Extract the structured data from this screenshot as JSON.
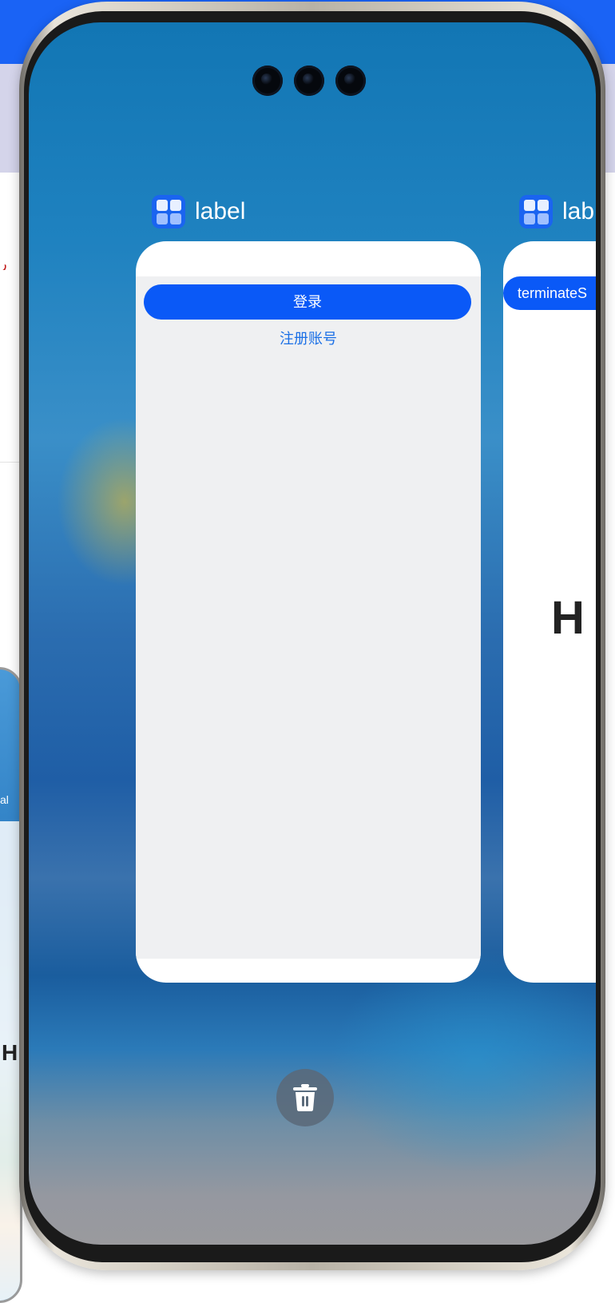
{
  "background": {
    "left_app_label_fragment": "al",
    "left_app_big_text_fragment": "H",
    "red_text_fragment": "ر"
  },
  "recent_apps": [
    {
      "label": "label",
      "icon": "app-grid-icon",
      "content": {
        "primary_button": "登录",
        "link": "注册账号"
      }
    },
    {
      "label": "lab",
      "icon": "app-grid-icon",
      "content": {
        "button": "terminateS",
        "big_text": "H"
      }
    }
  ],
  "controls": {
    "clear_all_icon": "trash-icon"
  },
  "colors": {
    "accent": "#0a59f7",
    "link": "#1a6fe6",
    "card_content_bg": "#eff0f2"
  }
}
